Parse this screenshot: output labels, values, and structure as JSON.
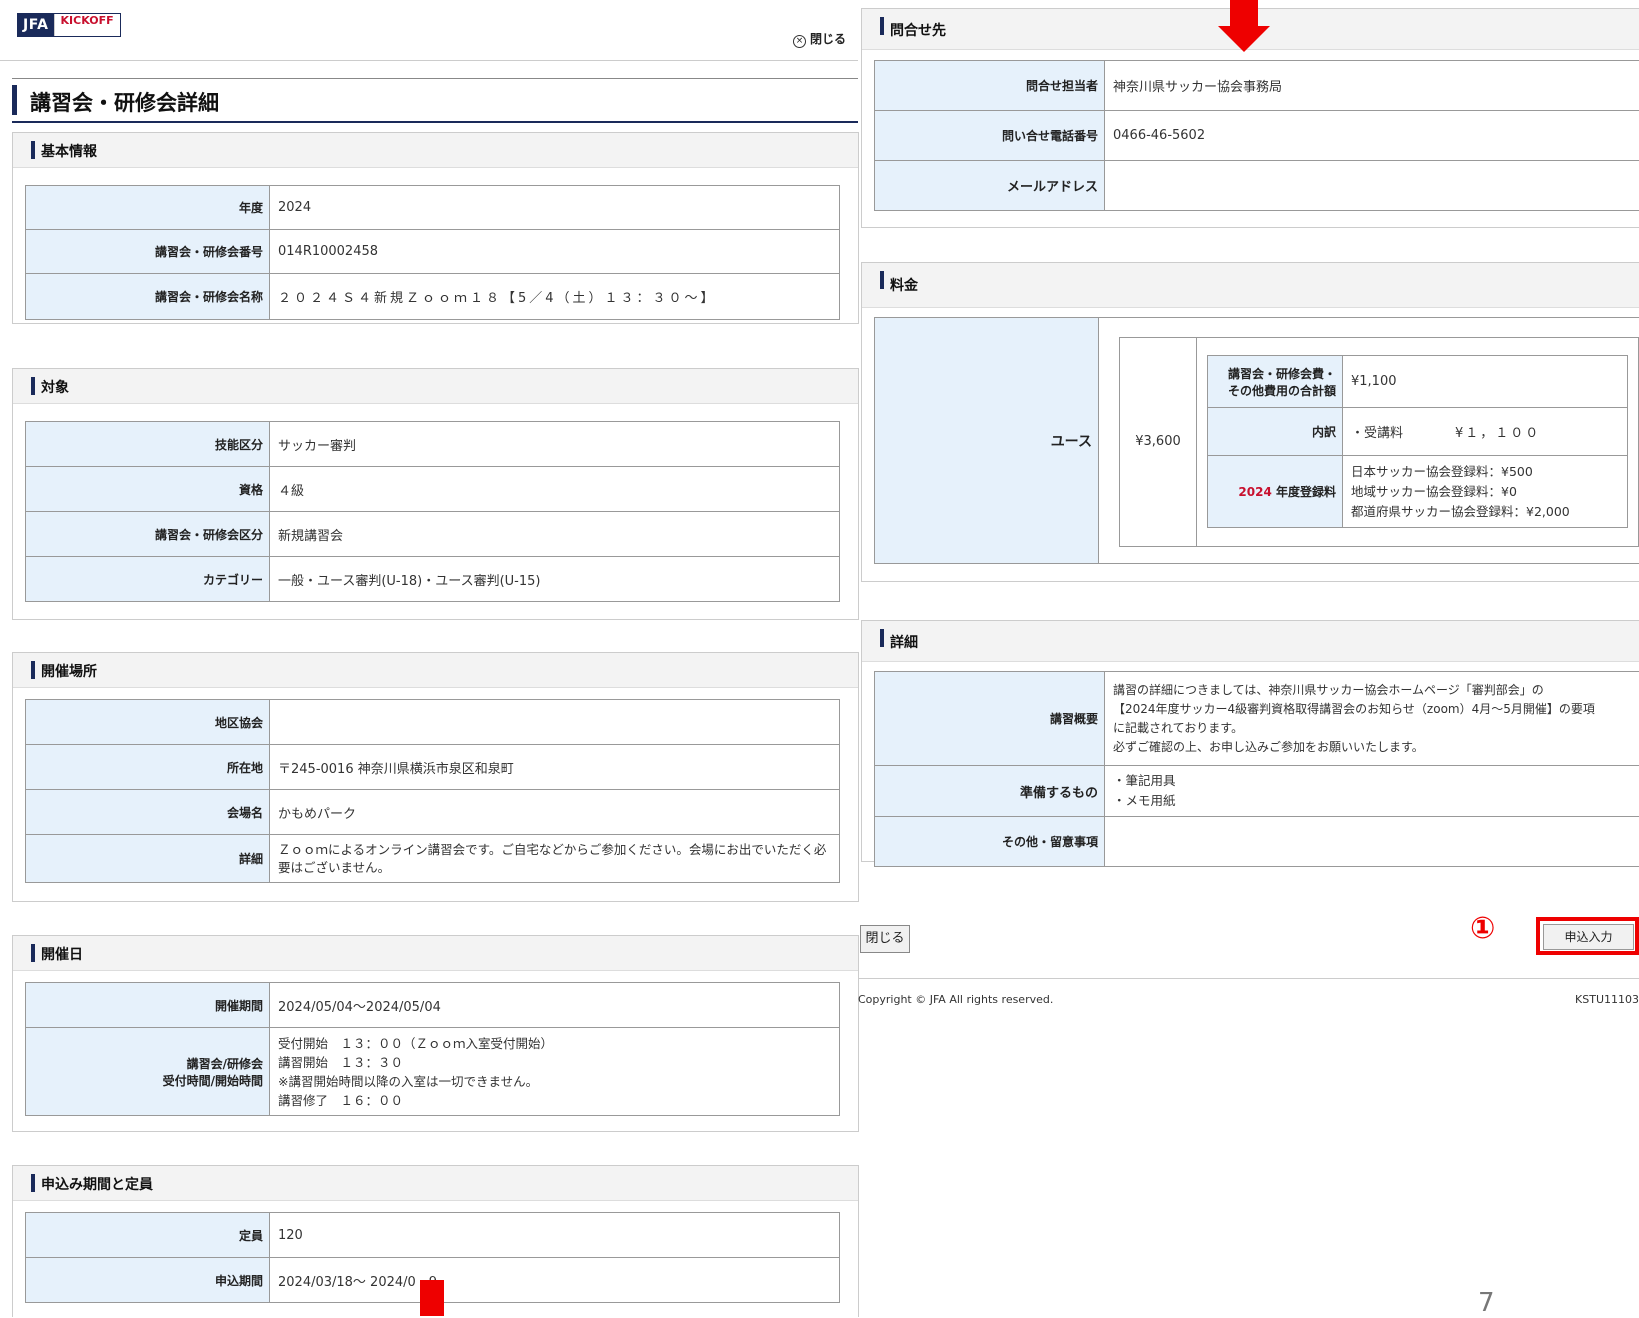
{
  "header": {
    "logo_jfa": "JFA",
    "logo_kickoff": "KICKOFF",
    "close_label": "閉じる"
  },
  "page_title": "講習会・研修会詳細",
  "basic": {
    "title": "基本情報",
    "rows": [
      {
        "label": "年度",
        "value": "2024"
      },
      {
        "label": "講習会・研修会番号",
        "value": "014R10002458"
      },
      {
        "label": "講習会・研修会名称",
        "value": "２０２４Ｓ４新規Ｚｏｏｍ１８【5／4（土）１３：３０〜】"
      }
    ]
  },
  "target": {
    "title": "対象",
    "rows": [
      {
        "label": "技能区分",
        "value": "サッカー審判"
      },
      {
        "label": "資格",
        "value": "４級"
      },
      {
        "label": "講習会・研修会区分",
        "value": "新規講習会"
      },
      {
        "label": "カテゴリー",
        "value": "一般・ユース審判(U-18)・ユース審判(U-15)"
      }
    ]
  },
  "venue": {
    "title": "開催場所",
    "rows": [
      {
        "label": "地区協会",
        "value": ""
      },
      {
        "label": "所在地",
        "value": "〒245-0016 神奈川県横浜市泉区和泉町"
      },
      {
        "label": "会場名",
        "value": "かもめパーク"
      },
      {
        "label": "詳細",
        "value": "Ｚｏｏｍによるオンライン講習会です。ご自宅などからご参加ください。会場にお出でいただく必要はございません。"
      }
    ]
  },
  "dates": {
    "title": "開催日",
    "period_label": "開催期間",
    "period_value": "2024/05/04〜2024/05/04",
    "time_label_1": "講習会/研修会",
    "time_label_2": "受付時間/開始時間",
    "time_lines": [
      "受付開始　１３：００（Ｚｏｏｍ入室受付開始）",
      "講習開始　１３：３０",
      "※講習開始時間以降の入室は一切できません。",
      "講習修了　１６：００"
    ]
  },
  "apply_period": {
    "title": "申込み期間と定員",
    "rows": [
      {
        "label": "定員",
        "value": "120"
      },
      {
        "label": "申込期間",
        "value": "2024/03/18〜 2024/0　9"
      }
    ]
  },
  "contact": {
    "title": "問合せ先",
    "rows": [
      {
        "label": "問合せ担当者",
        "value": "神奈川県サッカー協会事務局"
      },
      {
        "label": "問い合せ電話番号",
        "value": "0466-46-5602"
      },
      {
        "label": "メールアドレス",
        "value": ""
      }
    ]
  },
  "fee": {
    "title": "料金",
    "category": "ユース",
    "total": "¥3,600",
    "sum_label_1": "講習会・研修会費・",
    "sum_label_2": "その他費用の合計額",
    "sum_value": "¥1,100",
    "breakdown_label": "内訳",
    "breakdown_item": "・受講料",
    "breakdown_amount": "¥１，１００",
    "reg_year": "2024",
    "reg_label": "年度登録料",
    "reg_lines": [
      "日本サッカー協会登録料：¥500",
      "地域サッカー協会登録料：¥0",
      "都道府県サッカー協会登録料：¥2,000"
    ]
  },
  "details": {
    "title": "詳細",
    "summary_label": "講習概要",
    "summary_lines": [
      "講習の詳細につきましては、神奈川県サッカー協会ホームページ「審判部会」の",
      "【2024年度サッカー4級審判資格取得講習会のお知らせ（zoom）4月〜5月開催】の要項",
      "に記載されております。",
      "必ずご確認の上、お申し込みご参加をお願いいたします。"
    ],
    "prep_label": "準備するもの",
    "prep_lines": [
      "・筆記用具",
      "・メモ用紙"
    ],
    "other_label": "その他・留意事項",
    "other_value": ""
  },
  "footer": {
    "close_button": "閉じる",
    "apply_button": "申込入力",
    "marker": "①",
    "copyright": "Copyright © JFA All rights reserved.",
    "screen_id": "KSTU11103",
    "page_number": "7"
  },
  "colors": {
    "accent_navy": "#1a2a5a",
    "th_bg": "#e6f1fb",
    "highlight_red": "#ee0000"
  }
}
